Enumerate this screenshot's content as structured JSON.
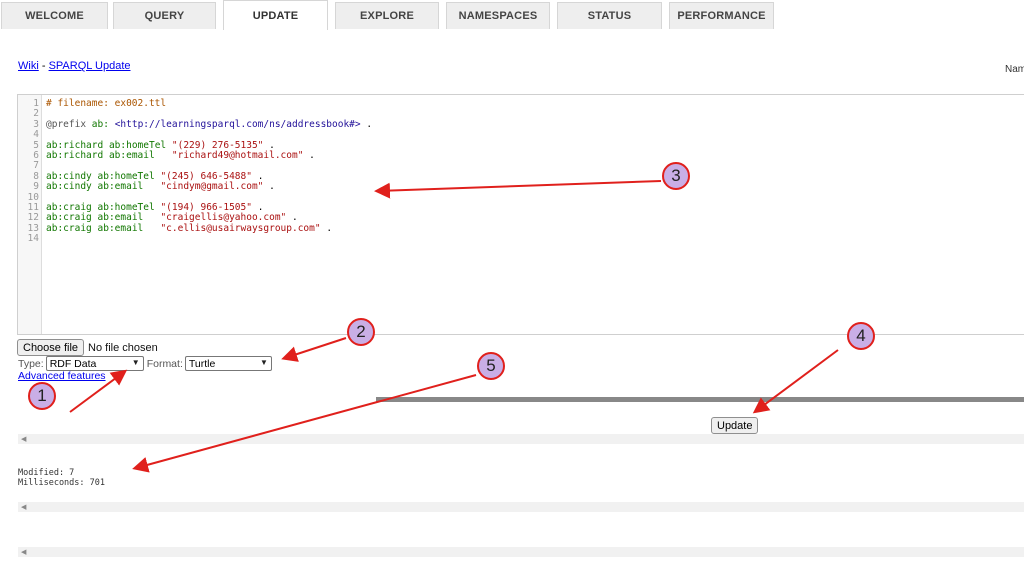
{
  "tabs": [
    {
      "label": "WELCOME"
    },
    {
      "label": "QUERY"
    },
    {
      "label": "UPDATE"
    },
    {
      "label": "EXPLORE"
    },
    {
      "label": "NAMESPACES"
    },
    {
      "label": "STATUS"
    },
    {
      "label": "PERFORMANCE"
    }
  ],
  "active_tab": "UPDATE",
  "links": {
    "wiki": "Wiki",
    "separator": " - ",
    "sparql_update": "SPARQL Update"
  },
  "namespace_label": "Nam",
  "editor": {
    "line_numbers": [
      "1",
      "2",
      "3",
      "4",
      "5",
      "6",
      "7",
      "8",
      "9",
      "10",
      "11",
      "12",
      "13",
      "14"
    ],
    "lines": [
      "# filename: ex002.ttl",
      "",
      "@prefix ab: <http://learningsparql.com/ns/addressbook#> .",
      "",
      "ab:richard ab:homeTel \"(229) 276-5135\" .",
      "ab:richard ab:email   \"richard49@hotmail.com\" .",
      "",
      "ab:cindy ab:homeTel \"(245) 646-5488\" .",
      "ab:cindy ab:email   \"cindym@gmail.com\" .",
      "",
      "ab:craig ab:homeTel \"(194) 966-1505\" .",
      "ab:craig ab:email   \"craigellis@yahoo.com\" .",
      "ab:craig ab:email   \"c.ellis@usairwaysgroup.com\" .",
      ""
    ]
  },
  "file_input": {
    "button_label": "Choose file",
    "status": "No file chosen"
  },
  "type_label": "Type:",
  "type_value": "RDF Data",
  "format_label": "Format:",
  "format_value": "Turtle",
  "advanced_features": "Advanced features",
  "update_button": "Update",
  "result": {
    "modified_line": "Modified: 7",
    "milliseconds_line": "Milliseconds: 701"
  },
  "annotations": [
    "1",
    "2",
    "3",
    "4",
    "5"
  ],
  "colors": {
    "badge_fill": "#c9aee6",
    "badge_border": "#e0201c",
    "arrow": "#e0201c",
    "link": "#0000ee"
  }
}
